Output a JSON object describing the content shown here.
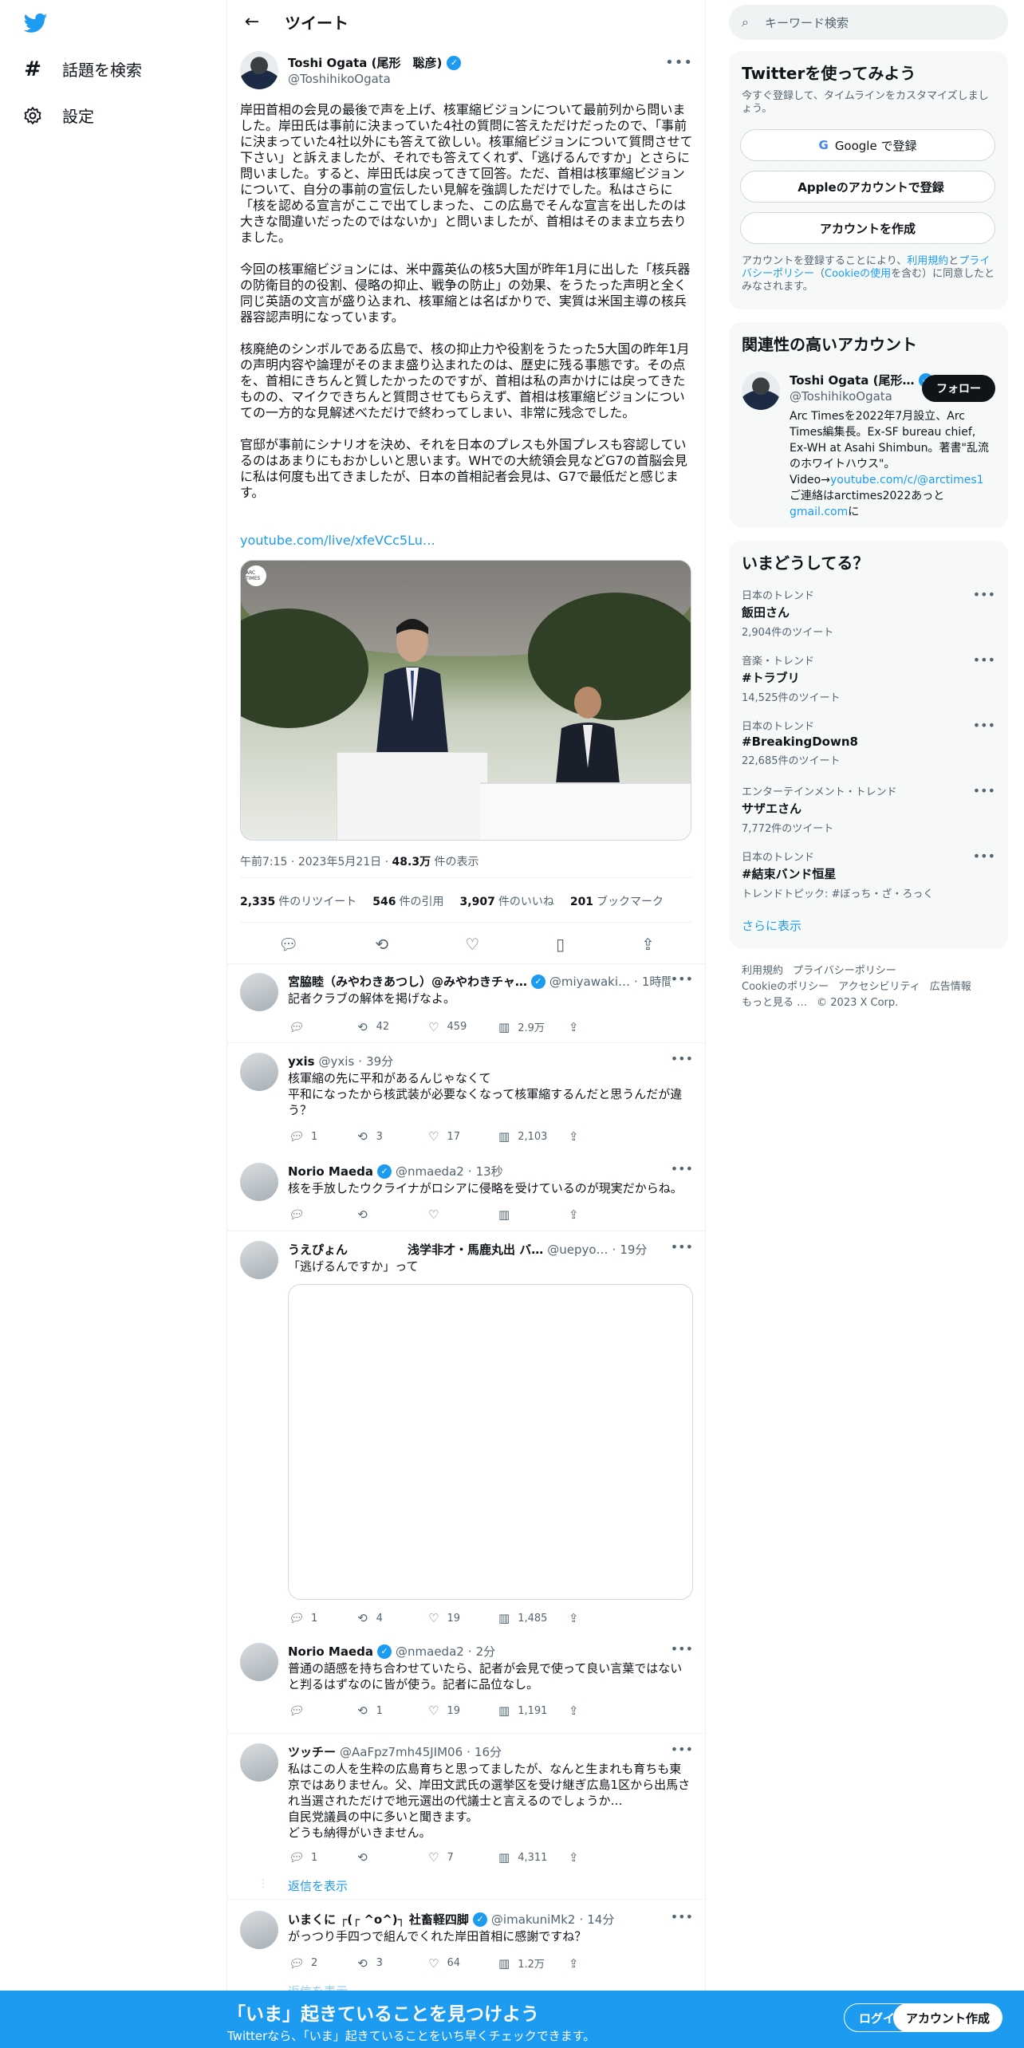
{
  "nav": {
    "logo": "twitter-bird",
    "items": [
      {
        "icon": "hashtag-icon",
        "label": "話題を検索"
      },
      {
        "icon": "gear-icon",
        "label": "設定"
      }
    ]
  },
  "header": {
    "title": "ツイート"
  },
  "tweet": {
    "author_name": "Toshi Ogata (尾形　聡彦)",
    "author_handle": "@ToshihikoOgata",
    "paragraphs": [
      "岸田首相の会見の最後で声を上げ、核軍縮ビジョンについて最前列から問いました。岸田氏は事前に決まっていた4社の質問に答えただけだったので、「事前に決まっていた4社以外にも答えて欲しい。核軍縮ビジョンについて質問させて下さい」と訴えましたが、それでも答えてくれず、「逃げるんですか」とさらに問いました。すると、岸田氏は戻ってきて回答。ただ、首相は核軍縮ビジョンについて、自分の事前の宣伝したい見解を強調しただけでした。私はさらに「核を認める宣言がここで出てしまった、この広島でそんな宣言を出したのは大きな間違いだったのではないか」と問いましたが、首相はそのまま立ち去りました。",
      "今回の核軍縮ビジョンには、米中露英仏の核5大国が昨年1月に出した「核兵器の防衛目的の役割、侵略の抑止、戦争の防止」の効果、をうたった声明と全く同じ英語の文言が盛り込まれ、核軍縮とは名ばかりで、実質は米国主導の核兵器容認声明になっています。",
      "核廃絶のシンボルである広島で、核の抑止力や役割をうたった5大国の昨年1月の声明内容や論理がそのまま盛り込まれたのは、歴史に残る事態です。その点を、首相にきちんと質したかったのですが、首相は私の声かけには戻ってきたものの、マイクできちんと質問させてもらえず、首相は核軍縮ビジョンについての一方的な見解述べただけで終わってしまい、非常に残念でした。",
      "官邸が事前にシナリオを決め、それを日本のプレスも外国プレスも容認しているのはあまりにもおかしいと思います。WHでの大統領会見などG7の首脳会見に私は何度も出てきましたが、日本の首相記者会見は、G7で最低だと感じます。"
    ],
    "link": "youtube.com/live/xfeVCc5Lu…",
    "time": "午前7:15",
    "date": "2023年5月21日",
    "views": "48.3万",
    "views_label": "件の表示",
    "stats": [
      {
        "num": "2,335",
        "label": "件のリツイート"
      },
      {
        "num": "546",
        "label": "件の引用"
      },
      {
        "num": "3,907",
        "label": "件のいいね"
      },
      {
        "num": "201",
        "label": "ブックマーク"
      }
    ]
  },
  "replies": [
    {
      "name": "宮脇睦（みやわきあつし）@みやわきチャ…",
      "verified": true,
      "handle": "@miyawaki…",
      "time": "1時間",
      "text": "記者クラブの解体を掲げなよ。",
      "reply": "",
      "rt": "42",
      "like": "459",
      "views": "2.9万"
    },
    {
      "name": "yxis",
      "verified": false,
      "handle": "@yxis",
      "time": "39分",
      "text": "核軍縮の先に平和があるんじゃなくて\n平和になったから核武装が必要なくなって核軍縮するんだと思うんだが違う？",
      "reply": "1",
      "rt": "3",
      "like": "17",
      "views": "2,103"
    },
    {
      "name": "Norio Maeda",
      "verified": true,
      "handle": "@nmaeda2",
      "time": "13秒",
      "text": "核を手放したウクライナがロシアに侵略を受けているのが現実だからね。",
      "reply": "",
      "rt": "",
      "like": "",
      "views": ""
    },
    {
      "name": "うえぴょん　　　　　浅学非才・馬鹿丸出 バ…",
      "verified": false,
      "handle": "@uepyo…",
      "time": "19分",
      "text": "「逃げるんですか」って",
      "reply": "1",
      "rt": "4",
      "like": "19",
      "views": "1,485"
    },
    {
      "name": "Norio Maeda",
      "verified": true,
      "handle": "@nmaeda2",
      "time": "2分",
      "text": "普通の語感を持ち合わせていたら、記者が会見で使って良い言葉ではないと判るはずなのに皆が使う。記者に品位なし。",
      "reply": "",
      "rt": "1",
      "like": "19",
      "views": "1,191"
    },
    {
      "name": "ツッチー",
      "verified": false,
      "handle": "@AaFpz7mh45JIM06",
      "time": "16分",
      "text": "私はこの人を生粋の広島育ちと思ってましたが、なんと生まれも育ちも東京ではありません。父、岸田文武氏の選挙区を受け継ぎ広島1区から出馬され当選されただけで地元選出の代議士と言えるのでしょうか…\n自民党議員の中に多いと聞きます。\nどうも納得がいきません。",
      "reply": "1",
      "rt": "",
      "like": "7",
      "views": "4,311"
    },
    {
      "name": "いまくに ┌(┌ ^o^)┐ 社畜軽四脚",
      "verified": true,
      "handle": "@imakuniMk2",
      "time": "14分",
      "text": "がっつり手四つで組んでくれた岸田首相に感謝ですね？",
      "reply": "2",
      "rt": "3",
      "like": "64",
      "views": "1.2万"
    }
  ],
  "show_replies": "返信を表示",
  "show_replies_2": "返信を表示",
  "right": {
    "search_placeholder": "キーワード検索",
    "signup": {
      "title": "Twitterを使ってみよう",
      "sub": "今すぐ登録して、タイムラインをカスタマイズしましょう。",
      "google": "Google で登録",
      "apple": "Appleのアカウントで登録",
      "create": "アカウントを作成",
      "terms_pre": "アカウントを登録することにより、",
      "terms_link1": "利用規約",
      "terms_mid1": "と",
      "terms_link2": "プライバシーポリシー",
      "terms_mid2": "（",
      "terms_link3": "Cookieの使用",
      "terms_post": "を含む）に同意したとみなされます。"
    },
    "related": {
      "title": "関連性の高いアカウント",
      "name": "Toshi Ogata (尾形…",
      "handle": "@ToshihikoOgata",
      "follow": "フォロー",
      "bio_pre": "Arc Timesを2022年7月設立、Arc Times編集長。Ex-SF bureau chief, Ex-WH at Asahi Shimbun。著書\"乱流のホワイトハウス\"。Video→",
      "bio_link": "youtube.com/c/@arctimes1",
      "bio_mid": "ご連絡はarctimes2022あっと",
      "bio_link2": "gmail.com",
      "bio_post": "に"
    },
    "trends": {
      "title": "いまどうしてる？",
      "items": [
        {
          "cat": "日本のトレンド",
          "name": "飯田さん",
          "count": "2,904件のツイート"
        },
        {
          "cat": "音楽・トレンド",
          "name": "#トラブリ",
          "count": "14,525件のツイート"
        },
        {
          "cat": "日本のトレンド",
          "name": "#BreakingDown8",
          "count": "22,685件のツイート"
        },
        {
          "cat": "エンターテインメント・トレンド",
          "name": "サザエさん",
          "count": "7,772件のツイート"
        },
        {
          "cat": "日本のトレンド",
          "name": "#結束バンド恒星",
          "count": "トレンドトピック: #ぼっち・ざ・ろっく"
        }
      ],
      "show_more": "さらに表示"
    },
    "footer": [
      "利用規約",
      "プライバシーポリシー",
      "Cookieのポリシー",
      "アクセシビリティ",
      "広告情報",
      "もっと見る …",
      "© 2023 X Corp."
    ]
  },
  "bottom": {
    "title": "「いま」起きていることを見つけよう",
    "sub": "Twitterなら、「いま」起きていることをいち早くチェックできます。",
    "login": "ログイン",
    "create": "アカウント作成"
  },
  "colors": {
    "accent": "#1d9bf0",
    "text": "#0f1419",
    "muted": "#536471"
  }
}
